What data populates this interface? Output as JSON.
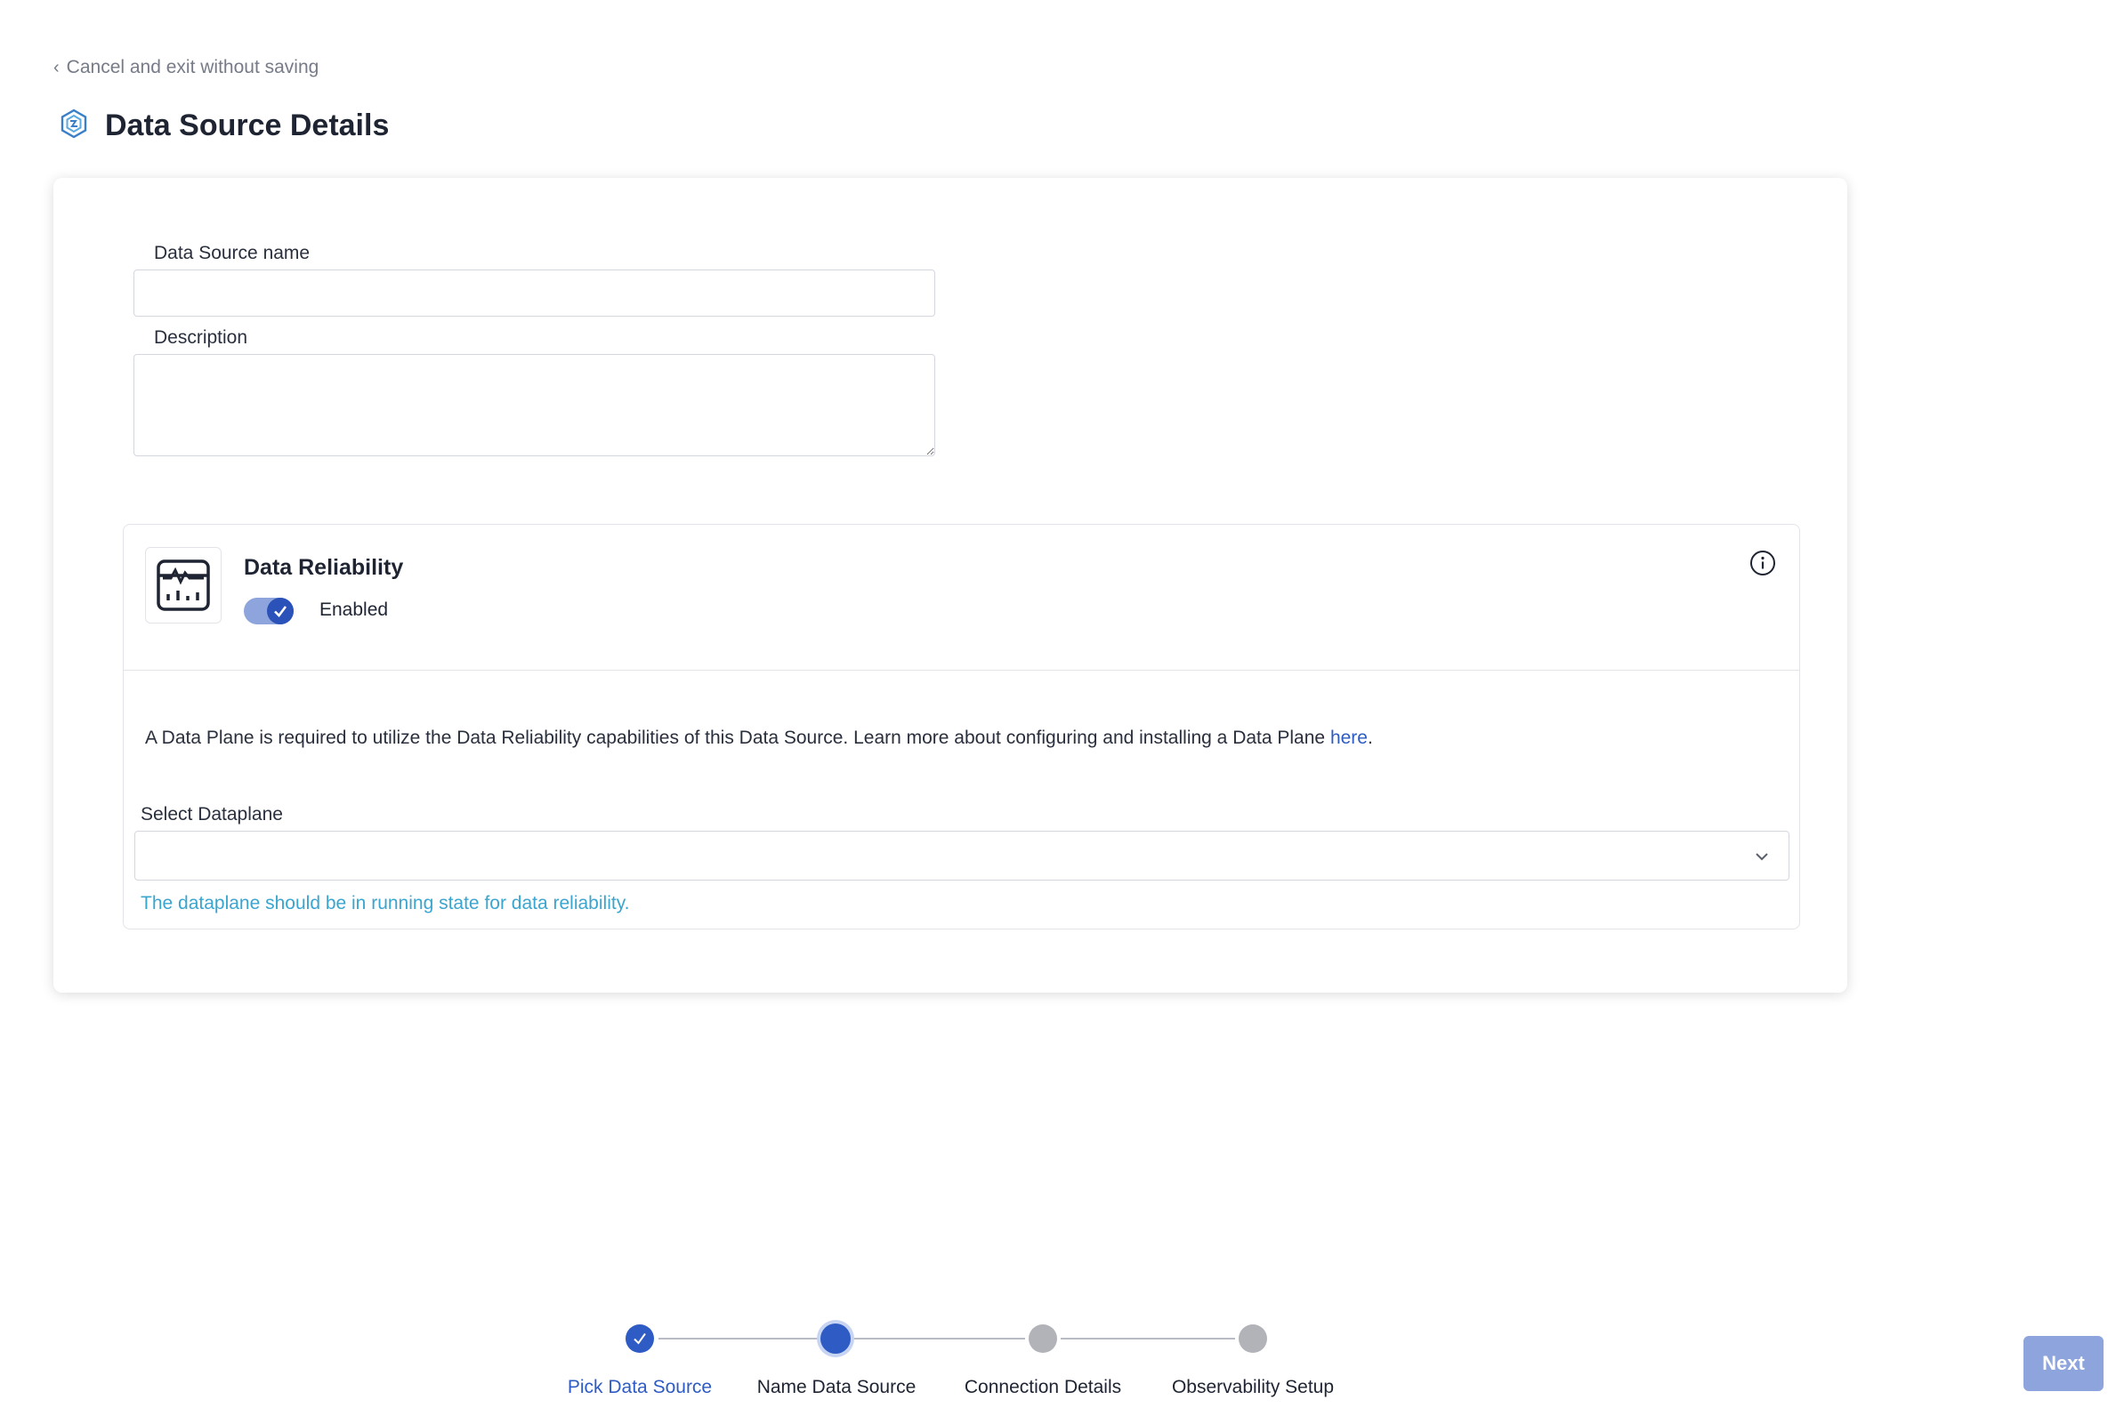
{
  "header": {
    "cancel_label": "Cancel and exit without saving",
    "title": "Data Source Details"
  },
  "form": {
    "name_label": "Data Source name",
    "name_value": "",
    "description_label": "Description",
    "description_value": ""
  },
  "data_reliability": {
    "title": "Data Reliability",
    "toggle_enabled": true,
    "toggle_label": "Enabled",
    "note_text": "A Data Plane is required to utilize the Data Reliability capabilities of this Data Source. Learn more about configuring and installing a Data Plane ",
    "note_link": "here",
    "note_suffix": ".",
    "select_label": "Select Dataplane",
    "select_value": "",
    "hint": "The dataplane should be in running state for data reliability."
  },
  "stepper": {
    "steps": [
      {
        "label": "Pick Data Source",
        "state": "done"
      },
      {
        "label": "Name Data Source",
        "state": "current"
      },
      {
        "label": "Connection Details",
        "state": "todo"
      },
      {
        "label": "Observability Setup",
        "state": "todo"
      }
    ]
  },
  "footer": {
    "next_label": "Next"
  },
  "colors": {
    "accent": "#2e5bc4",
    "hint": "#3aa5cf",
    "disabled_button": "#8ea4dc"
  },
  "icons": [
    "chevron-left-icon",
    "data-source-hex-icon",
    "monitor-pulse-icon",
    "check-icon",
    "info-icon",
    "chevron-down-icon"
  ]
}
